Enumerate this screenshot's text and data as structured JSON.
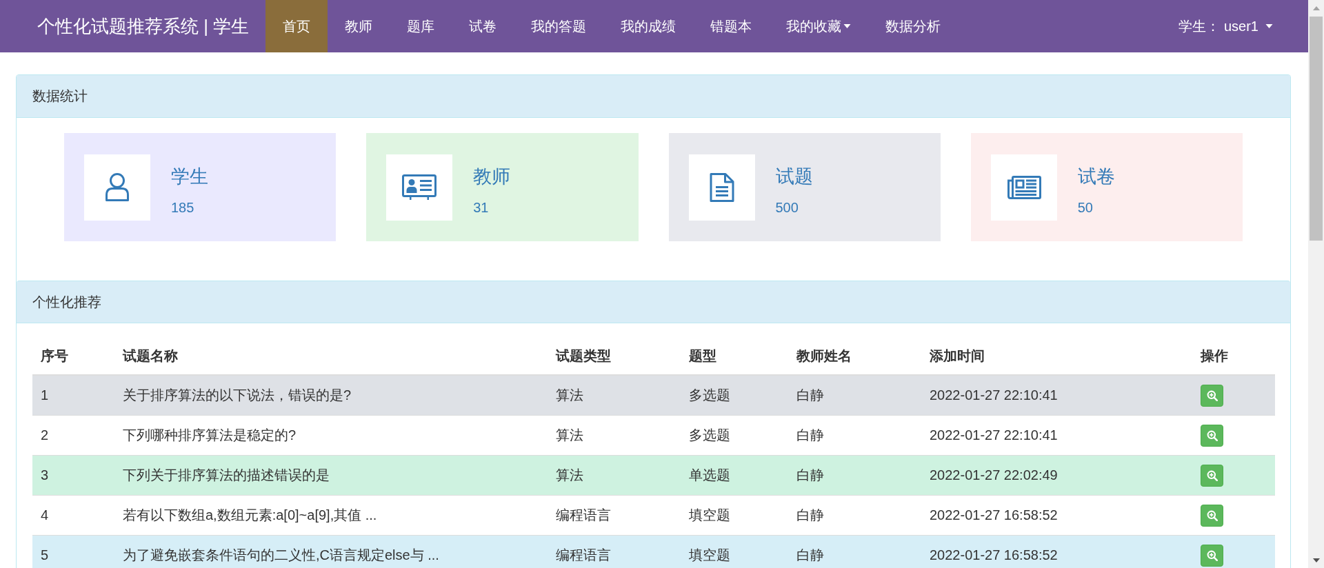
{
  "navbar": {
    "brand": "个性化试题推荐系统 | 学生",
    "items": [
      {
        "label": "首页",
        "selected": true,
        "dropdown": false
      },
      {
        "label": "教师",
        "selected": false,
        "dropdown": false
      },
      {
        "label": "题库",
        "selected": false,
        "dropdown": false
      },
      {
        "label": "试卷",
        "selected": false,
        "dropdown": false
      },
      {
        "label": "我的答题",
        "selected": false,
        "dropdown": false
      },
      {
        "label": "我的成绩",
        "selected": false,
        "dropdown": false
      },
      {
        "label": "错题本",
        "selected": false,
        "dropdown": false
      },
      {
        "label": "我的收藏",
        "selected": false,
        "dropdown": true
      },
      {
        "label": "数据分析",
        "selected": false,
        "dropdown": false
      }
    ],
    "user": {
      "label": "学生： user1",
      "dropdown": true
    }
  },
  "stats_panel": {
    "title": "数据统计",
    "stats": [
      {
        "label": "学生",
        "count": "185",
        "color": "#eae9fe"
      },
      {
        "label": "教师",
        "count": "31",
        "color": "#e0f5e2"
      },
      {
        "label": "试题",
        "count": "500",
        "color": "#e8e9ee"
      },
      {
        "label": "试卷",
        "count": "50",
        "color": "#fdeeee"
      }
    ]
  },
  "recommend_panel": {
    "title": "个性化推荐",
    "table": {
      "columns": [
        "序号",
        "试题名称",
        "试题类型",
        "题型",
        "教师姓名",
        "添加时间",
        "操作"
      ],
      "rows": [
        {
          "cells": [
            "1",
            "关于排序算法的以下说法，错误的是?",
            "算法",
            "多选题",
            "白静",
            "2022-01-27 22:10:41"
          ],
          "color": "#dee1e6"
        },
        {
          "cells": [
            "2",
            "下列哪种排序算法是稳定的?",
            "算法",
            "多选题",
            "白静",
            "2022-01-27 22:10:41"
          ],
          "color": "#ffffff"
        },
        {
          "cells": [
            "3",
            "下列关于排序算法的描述错误的是",
            "算法",
            "单选题",
            "白静",
            "2022-01-27 22:02:49"
          ],
          "color": "#cef2e0"
        },
        {
          "cells": [
            "4",
            "若有以下数组a,数组元素:a[0]~a[9],其值 ...",
            "编程语言",
            "填空题",
            "白静",
            "2022-01-27 16:58:52"
          ],
          "color": "#ffffff"
        },
        {
          "cells": [
            "5",
            "为了避免嵌套条件语句的二义性,C语言规定else与 ...",
            "编程语言",
            "填空题",
            "白静",
            "2022-01-27 16:58:52"
          ],
          "color": "#d6eef7"
        }
      ]
    }
  }
}
